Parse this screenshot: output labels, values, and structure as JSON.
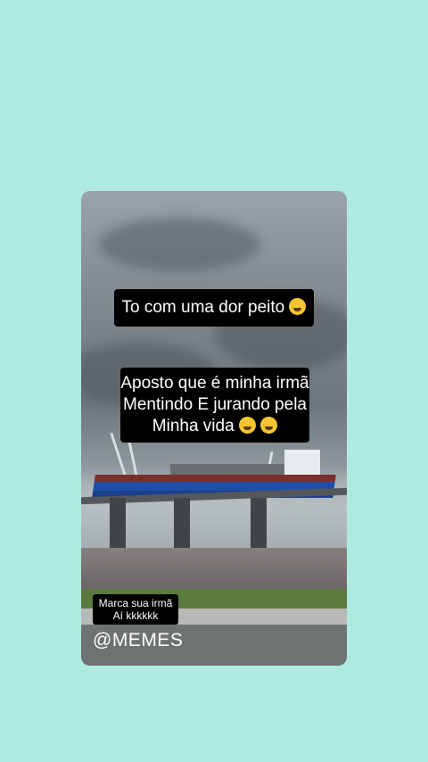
{
  "story": {
    "caption_top": "To com uma dor peito",
    "caption_main": {
      "line1": "Aposto que é minha irmã",
      "line2": "Mentindo E jurando pela",
      "line3": "Minha vida"
    },
    "tag": {
      "line1": "Marca sua irmã",
      "line2": "Aí kkkkkk"
    },
    "watermark": "@MEMES"
  },
  "icons": {
    "caption_top_emoji": "worried-face-icon",
    "caption_main_emoji": "laughing-tears-face-icon"
  },
  "colors": {
    "page_background": "#aeeae0",
    "caption_background": "#000000",
    "caption_text": "#ffffff"
  }
}
